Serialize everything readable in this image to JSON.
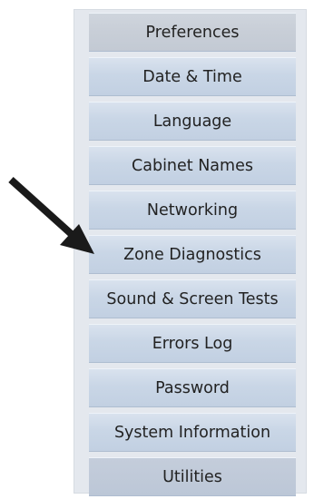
{
  "menu": {
    "items": [
      {
        "label": "Preferences"
      },
      {
        "label": "Date & Time"
      },
      {
        "label": "Language"
      },
      {
        "label": "Cabinet Names"
      },
      {
        "label": "Networking"
      },
      {
        "label": "Zone Diagnostics"
      },
      {
        "label": "Sound & Screen Tests"
      },
      {
        "label": "Errors Log"
      },
      {
        "label": "Password"
      },
      {
        "label": "System Information"
      },
      {
        "label": "Utilities"
      }
    ]
  },
  "annotation": {
    "arrow_icon": "arrow-pointer-icon",
    "color": "#1a1a1a"
  }
}
